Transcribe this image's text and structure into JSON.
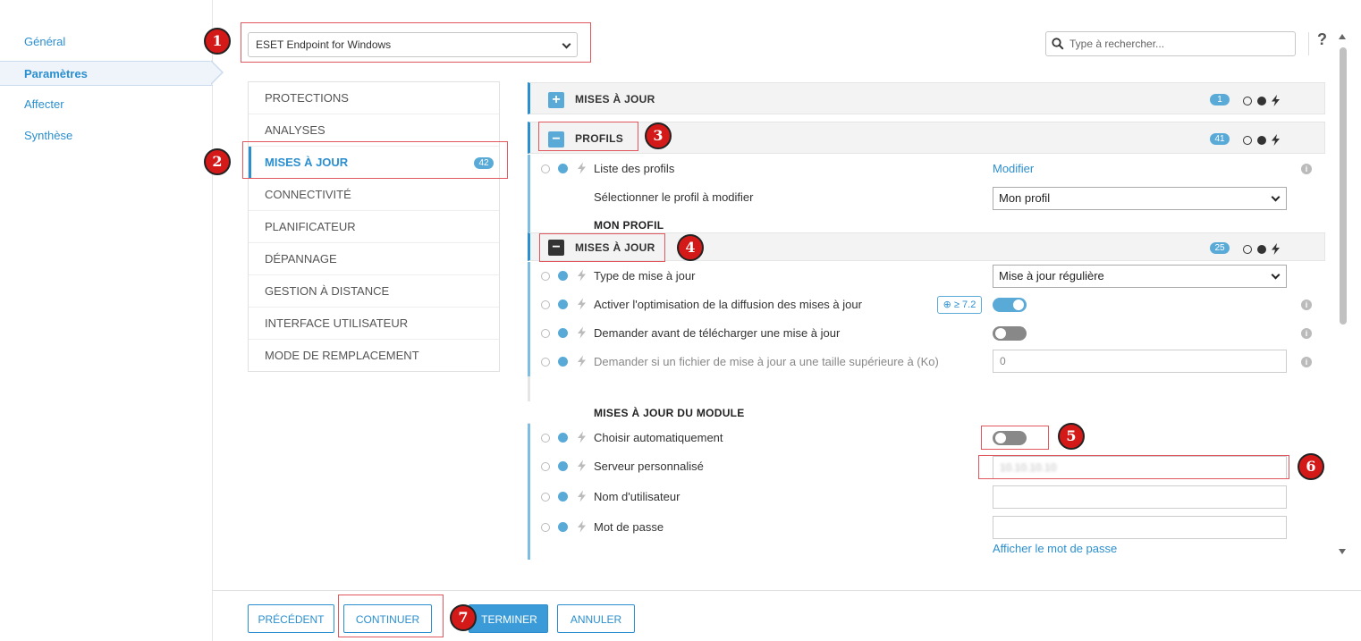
{
  "leftnav": {
    "items": [
      {
        "label": "Général",
        "active": false
      },
      {
        "label": "Paramètres",
        "active": true
      },
      {
        "label": "Affecter",
        "active": false
      },
      {
        "label": "Synthèse",
        "active": false
      }
    ]
  },
  "product_select": {
    "value": "ESET Endpoint for Windows"
  },
  "search": {
    "placeholder": "Type à rechercher..."
  },
  "help": {
    "label": "?"
  },
  "categories": [
    {
      "label": "PROTECTIONS"
    },
    {
      "label": "ANALYSES"
    },
    {
      "label": "MISES À JOUR",
      "badge": "42",
      "active": true
    },
    {
      "label": "CONNECTIVITÉ"
    },
    {
      "label": "PLANIFICATEUR"
    },
    {
      "label": "DÉPANNAGE"
    },
    {
      "label": "GESTION À DISTANCE"
    },
    {
      "label": "INTERFACE UTILISATEUR"
    },
    {
      "label": "MODE DE REMPLACEMENT"
    }
  ],
  "panel": {
    "section_updates": {
      "title": "MISES À JOUR",
      "badge": "1",
      "toggle": "+"
    },
    "section_profiles": {
      "title": "PROFILS",
      "badge": "41",
      "toggle": "−"
    },
    "profile_list": {
      "label": "Liste des profils",
      "link": "Modifier"
    },
    "profile_select": {
      "label": "Sélectionner le profil à modifier",
      "value": "Mon profil"
    },
    "my_profile_title": "MON PROFIL",
    "section_myupdates": {
      "title": "MISES À JOUR",
      "badge": "25",
      "toggle": "−"
    },
    "update_type": {
      "label": "Type de mise à jour",
      "value": "Mise à jour régulière"
    },
    "optimize": {
      "label": "Activer l'optimisation de la diffusion des mises à jour",
      "version": "⊕ ≥ 7.2",
      "enabled": true
    },
    "ask_before": {
      "label": "Demander avant de télécharger une mise à jour",
      "enabled": false
    },
    "ask_size": {
      "label": "Demander si un fichier de mise à jour a une taille supérieure à (Ko)",
      "value": "0"
    },
    "module_title": "MISES À JOUR DU MODULE",
    "auto_choose": {
      "label": "Choisir automatiquement",
      "enabled": false
    },
    "custom_server": {
      "label": "Serveur personnalisé",
      "value": "10.10.10.10"
    },
    "username": {
      "label": "Nom d'utilisateur",
      "value": ""
    },
    "password": {
      "label": "Mot de passe",
      "value": "",
      "show_link": "Afficher le mot de passe"
    }
  },
  "footer": {
    "previous": "PRÉCÉDENT",
    "continue": "CONTINUER",
    "finish": "TERMINER",
    "cancel": "ANNULER"
  },
  "markers": [
    "1",
    "2",
    "3",
    "4",
    "5",
    "6",
    "7"
  ],
  "colors": {
    "accent": "#2b8fcf",
    "annotation": "#d41919"
  }
}
